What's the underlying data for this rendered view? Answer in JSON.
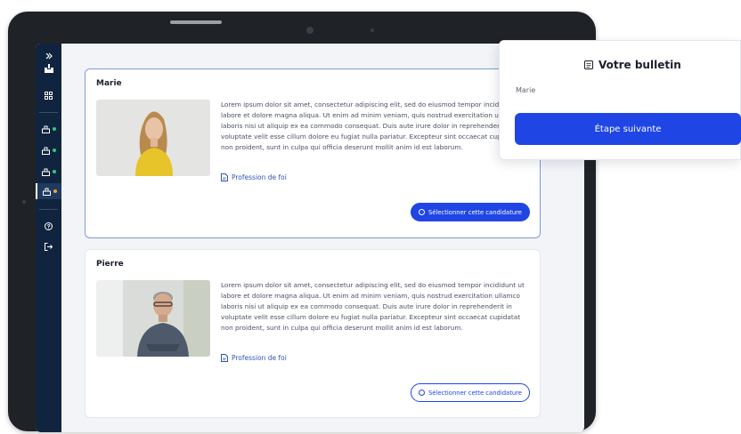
{
  "sidebar": {
    "expand_icon": "chevron-double-right-icon",
    "logo_icon": "ballot-logo-icon",
    "dashboard_icon": "grid-icon",
    "votes": [
      {
        "icon": "ballot-box-icon",
        "status_color": "#2ecc71"
      },
      {
        "icon": "ballot-box-icon",
        "status_color": "#2ecc71"
      },
      {
        "icon": "ballot-box-icon",
        "status_color": "#2ecc71"
      },
      {
        "icon": "ballot-box-icon",
        "status_color": "#f5a623",
        "active": true
      }
    ],
    "help_icon": "question-circle-icon",
    "logout_icon": "logout-icon"
  },
  "candidates": [
    {
      "name": "Marie",
      "description": "Lorem ipsum dolor sit amet, consectetur adipiscing elit, sed do eiusmod tempor incididunt ut labore et dolore magna aliqua. Ut enim ad minim veniam, quis nostrud exercitation ullamco laboris nisi ut aliquip ex ea commodo consequat. Duis aute irure dolor in reprehenderit in voluptate velit esse cillum dolore eu fugiat nulla pariatur. Excepteur sint occaecat cupidatat non proident, sunt in culpa qui officia deserunt mollit anim id est laborum.",
      "link_label": "Profession de foi",
      "button_label": "Sélectionner cette candidature",
      "selected": true
    },
    {
      "name": "Pierre",
      "description": "Lorem ipsum dolor sit amet, consectetur adipiscing elit, sed do eiusmod tempor incididunt ut labore et dolore magna aliqua. Ut enim ad minim veniam, quis nostrud exercitation ullamco laboris nisi ut aliquip ex ea commodo consequat. Duis aute irure dolor in reprehenderit in voluptate velit esse cillum dolore eu fugiat nulla pariatur. Excepteur sint occaecat cupidatat non proident, sunt in culpa qui officia deserunt mollit anim id est laborum.",
      "link_label": "Profession de foi",
      "button_label": "Sélectionner cette candidature",
      "selected": false
    }
  ],
  "bulletin": {
    "title": "Votre bulletin",
    "selected_candidate": "Marie",
    "next_button": "Étape suivante"
  },
  "colors": {
    "primary": "#1f46e5",
    "sidebar_bg": "#10243f",
    "link": "#2f55b4"
  }
}
